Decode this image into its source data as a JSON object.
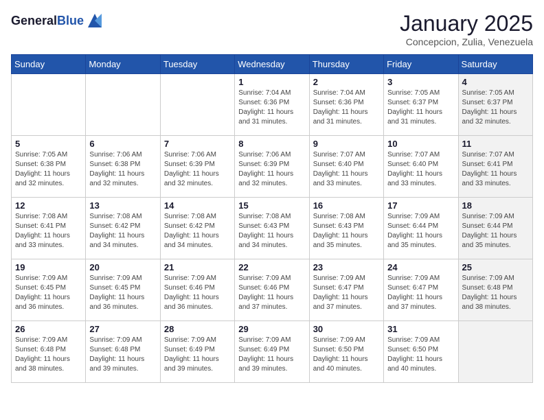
{
  "header": {
    "logo_general": "General",
    "logo_blue": "Blue",
    "month": "January 2025",
    "location": "Concepcion, Zulia, Venezuela"
  },
  "weekdays": [
    "Sunday",
    "Monday",
    "Tuesday",
    "Wednesday",
    "Thursday",
    "Friday",
    "Saturday"
  ],
  "weeks": [
    [
      {
        "day": "",
        "info": "",
        "shaded": false
      },
      {
        "day": "",
        "info": "",
        "shaded": false
      },
      {
        "day": "",
        "info": "",
        "shaded": false
      },
      {
        "day": "1",
        "info": "Sunrise: 7:04 AM\nSunset: 6:36 PM\nDaylight: 11 hours\nand 31 minutes.",
        "shaded": false
      },
      {
        "day": "2",
        "info": "Sunrise: 7:04 AM\nSunset: 6:36 PM\nDaylight: 11 hours\nand 31 minutes.",
        "shaded": false
      },
      {
        "day": "3",
        "info": "Sunrise: 7:05 AM\nSunset: 6:37 PM\nDaylight: 11 hours\nand 31 minutes.",
        "shaded": false
      },
      {
        "day": "4",
        "info": "Sunrise: 7:05 AM\nSunset: 6:37 PM\nDaylight: 11 hours\nand 32 minutes.",
        "shaded": true
      }
    ],
    [
      {
        "day": "5",
        "info": "Sunrise: 7:05 AM\nSunset: 6:38 PM\nDaylight: 11 hours\nand 32 minutes.",
        "shaded": false
      },
      {
        "day": "6",
        "info": "Sunrise: 7:06 AM\nSunset: 6:38 PM\nDaylight: 11 hours\nand 32 minutes.",
        "shaded": false
      },
      {
        "day": "7",
        "info": "Sunrise: 7:06 AM\nSunset: 6:39 PM\nDaylight: 11 hours\nand 32 minutes.",
        "shaded": false
      },
      {
        "day": "8",
        "info": "Sunrise: 7:06 AM\nSunset: 6:39 PM\nDaylight: 11 hours\nand 32 minutes.",
        "shaded": false
      },
      {
        "day": "9",
        "info": "Sunrise: 7:07 AM\nSunset: 6:40 PM\nDaylight: 11 hours\nand 33 minutes.",
        "shaded": false
      },
      {
        "day": "10",
        "info": "Sunrise: 7:07 AM\nSunset: 6:40 PM\nDaylight: 11 hours\nand 33 minutes.",
        "shaded": false
      },
      {
        "day": "11",
        "info": "Sunrise: 7:07 AM\nSunset: 6:41 PM\nDaylight: 11 hours\nand 33 minutes.",
        "shaded": true
      }
    ],
    [
      {
        "day": "12",
        "info": "Sunrise: 7:08 AM\nSunset: 6:41 PM\nDaylight: 11 hours\nand 33 minutes.",
        "shaded": false
      },
      {
        "day": "13",
        "info": "Sunrise: 7:08 AM\nSunset: 6:42 PM\nDaylight: 11 hours\nand 34 minutes.",
        "shaded": false
      },
      {
        "day": "14",
        "info": "Sunrise: 7:08 AM\nSunset: 6:42 PM\nDaylight: 11 hours\nand 34 minutes.",
        "shaded": false
      },
      {
        "day": "15",
        "info": "Sunrise: 7:08 AM\nSunset: 6:43 PM\nDaylight: 11 hours\nand 34 minutes.",
        "shaded": false
      },
      {
        "day": "16",
        "info": "Sunrise: 7:08 AM\nSunset: 6:43 PM\nDaylight: 11 hours\nand 35 minutes.",
        "shaded": false
      },
      {
        "day": "17",
        "info": "Sunrise: 7:09 AM\nSunset: 6:44 PM\nDaylight: 11 hours\nand 35 minutes.",
        "shaded": false
      },
      {
        "day": "18",
        "info": "Sunrise: 7:09 AM\nSunset: 6:44 PM\nDaylight: 11 hours\nand 35 minutes.",
        "shaded": true
      }
    ],
    [
      {
        "day": "19",
        "info": "Sunrise: 7:09 AM\nSunset: 6:45 PM\nDaylight: 11 hours\nand 36 minutes.",
        "shaded": false
      },
      {
        "day": "20",
        "info": "Sunrise: 7:09 AM\nSunset: 6:45 PM\nDaylight: 11 hours\nand 36 minutes.",
        "shaded": false
      },
      {
        "day": "21",
        "info": "Sunrise: 7:09 AM\nSunset: 6:46 PM\nDaylight: 11 hours\nand 36 minutes.",
        "shaded": false
      },
      {
        "day": "22",
        "info": "Sunrise: 7:09 AM\nSunset: 6:46 PM\nDaylight: 11 hours\nand 37 minutes.",
        "shaded": false
      },
      {
        "day": "23",
        "info": "Sunrise: 7:09 AM\nSunset: 6:47 PM\nDaylight: 11 hours\nand 37 minutes.",
        "shaded": false
      },
      {
        "day": "24",
        "info": "Sunrise: 7:09 AM\nSunset: 6:47 PM\nDaylight: 11 hours\nand 37 minutes.",
        "shaded": false
      },
      {
        "day": "25",
        "info": "Sunrise: 7:09 AM\nSunset: 6:48 PM\nDaylight: 11 hours\nand 38 minutes.",
        "shaded": true
      }
    ],
    [
      {
        "day": "26",
        "info": "Sunrise: 7:09 AM\nSunset: 6:48 PM\nDaylight: 11 hours\nand 38 minutes.",
        "shaded": false
      },
      {
        "day": "27",
        "info": "Sunrise: 7:09 AM\nSunset: 6:48 PM\nDaylight: 11 hours\nand 39 minutes.",
        "shaded": false
      },
      {
        "day": "28",
        "info": "Sunrise: 7:09 AM\nSunset: 6:49 PM\nDaylight: 11 hours\nand 39 minutes.",
        "shaded": false
      },
      {
        "day": "29",
        "info": "Sunrise: 7:09 AM\nSunset: 6:49 PM\nDaylight: 11 hours\nand 39 minutes.",
        "shaded": false
      },
      {
        "day": "30",
        "info": "Sunrise: 7:09 AM\nSunset: 6:50 PM\nDaylight: 11 hours\nand 40 minutes.",
        "shaded": false
      },
      {
        "day": "31",
        "info": "Sunrise: 7:09 AM\nSunset: 6:50 PM\nDaylight: 11 hours\nand 40 minutes.",
        "shaded": false
      },
      {
        "day": "",
        "info": "",
        "shaded": true
      }
    ]
  ]
}
